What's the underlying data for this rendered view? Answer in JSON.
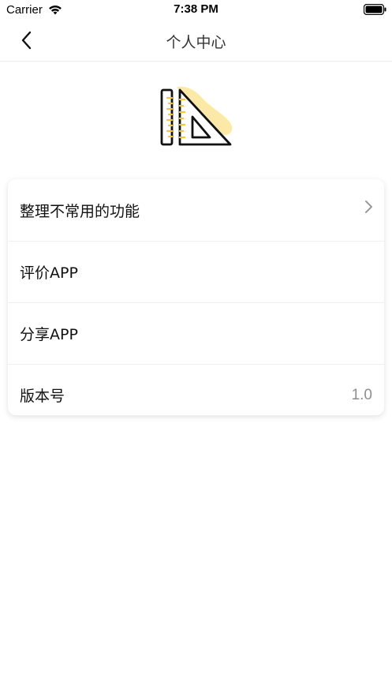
{
  "status_bar": {
    "carrier": "Carrier",
    "time": "7:38 PM"
  },
  "nav": {
    "title": "个人中心"
  },
  "menu": {
    "items": [
      {
        "label": "整理不常用的功能",
        "value": "",
        "chevron": true
      },
      {
        "label": "评价APP",
        "value": "",
        "chevron": false
      },
      {
        "label": "分享APP",
        "value": "",
        "chevron": false
      },
      {
        "label": "版本号",
        "value": "1.0",
        "chevron": false
      }
    ]
  },
  "colors": {
    "accent": "#F4C545",
    "accent_light": "#FCE9A8"
  },
  "icons": [
    "wifi-icon",
    "battery-icon",
    "back-chevron-icon",
    "ruler-triangle-logo-icon",
    "chevron-right-icon"
  ]
}
